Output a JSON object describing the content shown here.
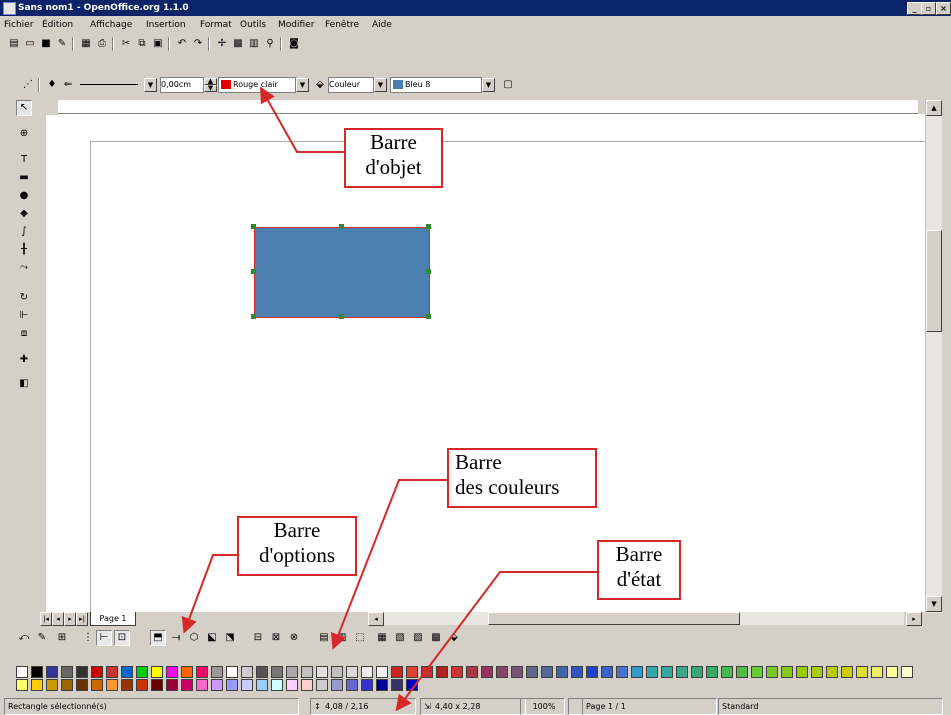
{
  "window": {
    "title": "Sans nom1 - OpenOffice.org 1.1.0",
    "minimize_icon": "minimize-icon",
    "maximize_icon": "maximize-icon",
    "close_icon": "close-icon",
    "minimize_label": "_",
    "maximize_label": "▫",
    "close_label": "×"
  },
  "menu": [
    "Fichier",
    "Édition",
    "Affichage",
    "Insertion",
    "Format",
    "Outils",
    "Modifier",
    "Fenêtre",
    "Aide"
  ],
  "object_bar": {
    "line_width": "0,00cm",
    "line_color": "Rouge clair",
    "area_style": "Couleur",
    "area_color": "Bleu 8"
  },
  "page_tab": {
    "label": "Page 1"
  },
  "status": {
    "selection": "Rectangle sélectionné(s)",
    "position": "4,08 / 2,16",
    "size": "4,40 x 2,28",
    "zoom": "100%",
    "page": "Page 1 / 1",
    "layout": "Standard"
  },
  "callouts": {
    "object_bar": [
      "Barre",
      "d'objet"
    ],
    "color_bar": [
      "Barre",
      "des couleurs"
    ],
    "options_bar": [
      "Barre",
      "d'options"
    ],
    "status_bar": [
      "Barre",
      "d'état"
    ]
  },
  "colors": {
    "rect_fill": "#4a7fb0",
    "rect_border": "#d62828",
    "callout_border": "#d62828",
    "titlebar": "#0a246a",
    "palette_row1": [
      "#ffffff",
      "#000000",
      "#333399",
      "#666666",
      "#333333",
      "#cc0000",
      "#cc3333",
      "#0066cc",
      "#00cc00",
      "#ffff00",
      "#ff00ff",
      "#ff6600",
      "#ff0066",
      "#999999",
      "#ffffff",
      "#cccccc",
      "#555555",
      "#777777",
      "#aaaaaa",
      "#c0c0c0",
      "#e0e0e0",
      "#bfbfbf",
      "#d9d9d9",
      "#eeeeee",
      "#f2f2f2",
      "#cc2222",
      "#dd4433",
      "#c83030",
      "#b02020",
      "#cc3333",
      "#aa3344",
      "#993355",
      "#884466",
      "#775577",
      "#666688",
      "#556699",
      "#4466aa",
      "#3355bb",
      "#2244cc",
      "#3366cc",
      "#4477cc",
      "#3399cc",
      "#33aaaa",
      "#33aa99",
      "#33aa88",
      "#33aa77",
      "#33aa66",
      "#44bb55",
      "#55bb44",
      "#66cc33",
      "#77cc22",
      "#88cc11",
      "#99cc00",
      "#aacc00",
      "#bbcc00",
      "#cccc00",
      "#dddd33",
      "#eeee66",
      "#ffff99",
      "#ffffcc"
    ],
    "palette_row2": [
      "#ffff66",
      "#ffcc00",
      "#cc9900",
      "#996600",
      "#663300",
      "#cc6600",
      "#ff9933",
      "#993300",
      "#cc3300",
      "#660000",
      "#990033",
      "#cc0066",
      "#ff66cc",
      "#cc99ff",
      "#9999ff",
      "#ccccff",
      "#99ccff",
      "#ccffff",
      "#ffccff",
      "#ffcccc",
      "#cccccc",
      "#9999cc",
      "#6666cc",
      "#3333cc",
      "#000099",
      "#333366",
      "#0000cc"
    ]
  }
}
